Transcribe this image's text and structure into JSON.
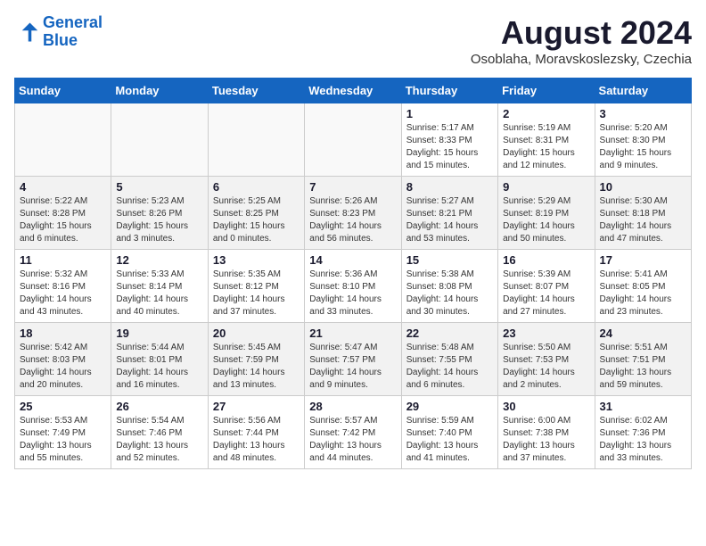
{
  "logo": {
    "line1": "General",
    "line2": "Blue"
  },
  "title": "August 2024",
  "subtitle": "Osoblaha, Moravskoslezsky, Czechia",
  "headers": [
    "Sunday",
    "Monday",
    "Tuesday",
    "Wednesday",
    "Thursday",
    "Friday",
    "Saturday"
  ],
  "weeks": [
    {
      "days": [
        {
          "num": "",
          "info": ""
        },
        {
          "num": "",
          "info": ""
        },
        {
          "num": "",
          "info": ""
        },
        {
          "num": "",
          "info": ""
        },
        {
          "num": "1",
          "info": "Sunrise: 5:17 AM\nSunset: 8:33 PM\nDaylight: 15 hours\nand 15 minutes."
        },
        {
          "num": "2",
          "info": "Sunrise: 5:19 AM\nSunset: 8:31 PM\nDaylight: 15 hours\nand 12 minutes."
        },
        {
          "num": "3",
          "info": "Sunrise: 5:20 AM\nSunset: 8:30 PM\nDaylight: 15 hours\nand 9 minutes."
        }
      ]
    },
    {
      "days": [
        {
          "num": "4",
          "info": "Sunrise: 5:22 AM\nSunset: 8:28 PM\nDaylight: 15 hours\nand 6 minutes."
        },
        {
          "num": "5",
          "info": "Sunrise: 5:23 AM\nSunset: 8:26 PM\nDaylight: 15 hours\nand 3 minutes."
        },
        {
          "num": "6",
          "info": "Sunrise: 5:25 AM\nSunset: 8:25 PM\nDaylight: 15 hours\nand 0 minutes."
        },
        {
          "num": "7",
          "info": "Sunrise: 5:26 AM\nSunset: 8:23 PM\nDaylight: 14 hours\nand 56 minutes."
        },
        {
          "num": "8",
          "info": "Sunrise: 5:27 AM\nSunset: 8:21 PM\nDaylight: 14 hours\nand 53 minutes."
        },
        {
          "num": "9",
          "info": "Sunrise: 5:29 AM\nSunset: 8:19 PM\nDaylight: 14 hours\nand 50 minutes."
        },
        {
          "num": "10",
          "info": "Sunrise: 5:30 AM\nSunset: 8:18 PM\nDaylight: 14 hours\nand 47 minutes."
        }
      ]
    },
    {
      "days": [
        {
          "num": "11",
          "info": "Sunrise: 5:32 AM\nSunset: 8:16 PM\nDaylight: 14 hours\nand 43 minutes."
        },
        {
          "num": "12",
          "info": "Sunrise: 5:33 AM\nSunset: 8:14 PM\nDaylight: 14 hours\nand 40 minutes."
        },
        {
          "num": "13",
          "info": "Sunrise: 5:35 AM\nSunset: 8:12 PM\nDaylight: 14 hours\nand 37 minutes."
        },
        {
          "num": "14",
          "info": "Sunrise: 5:36 AM\nSunset: 8:10 PM\nDaylight: 14 hours\nand 33 minutes."
        },
        {
          "num": "15",
          "info": "Sunrise: 5:38 AM\nSunset: 8:08 PM\nDaylight: 14 hours\nand 30 minutes."
        },
        {
          "num": "16",
          "info": "Sunrise: 5:39 AM\nSunset: 8:07 PM\nDaylight: 14 hours\nand 27 minutes."
        },
        {
          "num": "17",
          "info": "Sunrise: 5:41 AM\nSunset: 8:05 PM\nDaylight: 14 hours\nand 23 minutes."
        }
      ]
    },
    {
      "days": [
        {
          "num": "18",
          "info": "Sunrise: 5:42 AM\nSunset: 8:03 PM\nDaylight: 14 hours\nand 20 minutes."
        },
        {
          "num": "19",
          "info": "Sunrise: 5:44 AM\nSunset: 8:01 PM\nDaylight: 14 hours\nand 16 minutes."
        },
        {
          "num": "20",
          "info": "Sunrise: 5:45 AM\nSunset: 7:59 PM\nDaylight: 14 hours\nand 13 minutes."
        },
        {
          "num": "21",
          "info": "Sunrise: 5:47 AM\nSunset: 7:57 PM\nDaylight: 14 hours\nand 9 minutes."
        },
        {
          "num": "22",
          "info": "Sunrise: 5:48 AM\nSunset: 7:55 PM\nDaylight: 14 hours\nand 6 minutes."
        },
        {
          "num": "23",
          "info": "Sunrise: 5:50 AM\nSunset: 7:53 PM\nDaylight: 14 hours\nand 2 minutes."
        },
        {
          "num": "24",
          "info": "Sunrise: 5:51 AM\nSunset: 7:51 PM\nDaylight: 13 hours\nand 59 minutes."
        }
      ]
    },
    {
      "days": [
        {
          "num": "25",
          "info": "Sunrise: 5:53 AM\nSunset: 7:49 PM\nDaylight: 13 hours\nand 55 minutes."
        },
        {
          "num": "26",
          "info": "Sunrise: 5:54 AM\nSunset: 7:46 PM\nDaylight: 13 hours\nand 52 minutes."
        },
        {
          "num": "27",
          "info": "Sunrise: 5:56 AM\nSunset: 7:44 PM\nDaylight: 13 hours\nand 48 minutes."
        },
        {
          "num": "28",
          "info": "Sunrise: 5:57 AM\nSunset: 7:42 PM\nDaylight: 13 hours\nand 44 minutes."
        },
        {
          "num": "29",
          "info": "Sunrise: 5:59 AM\nSunset: 7:40 PM\nDaylight: 13 hours\nand 41 minutes."
        },
        {
          "num": "30",
          "info": "Sunrise: 6:00 AM\nSunset: 7:38 PM\nDaylight: 13 hours\nand 37 minutes."
        },
        {
          "num": "31",
          "info": "Sunrise: 6:02 AM\nSunset: 7:36 PM\nDaylight: 13 hours\nand 33 minutes."
        }
      ]
    }
  ]
}
